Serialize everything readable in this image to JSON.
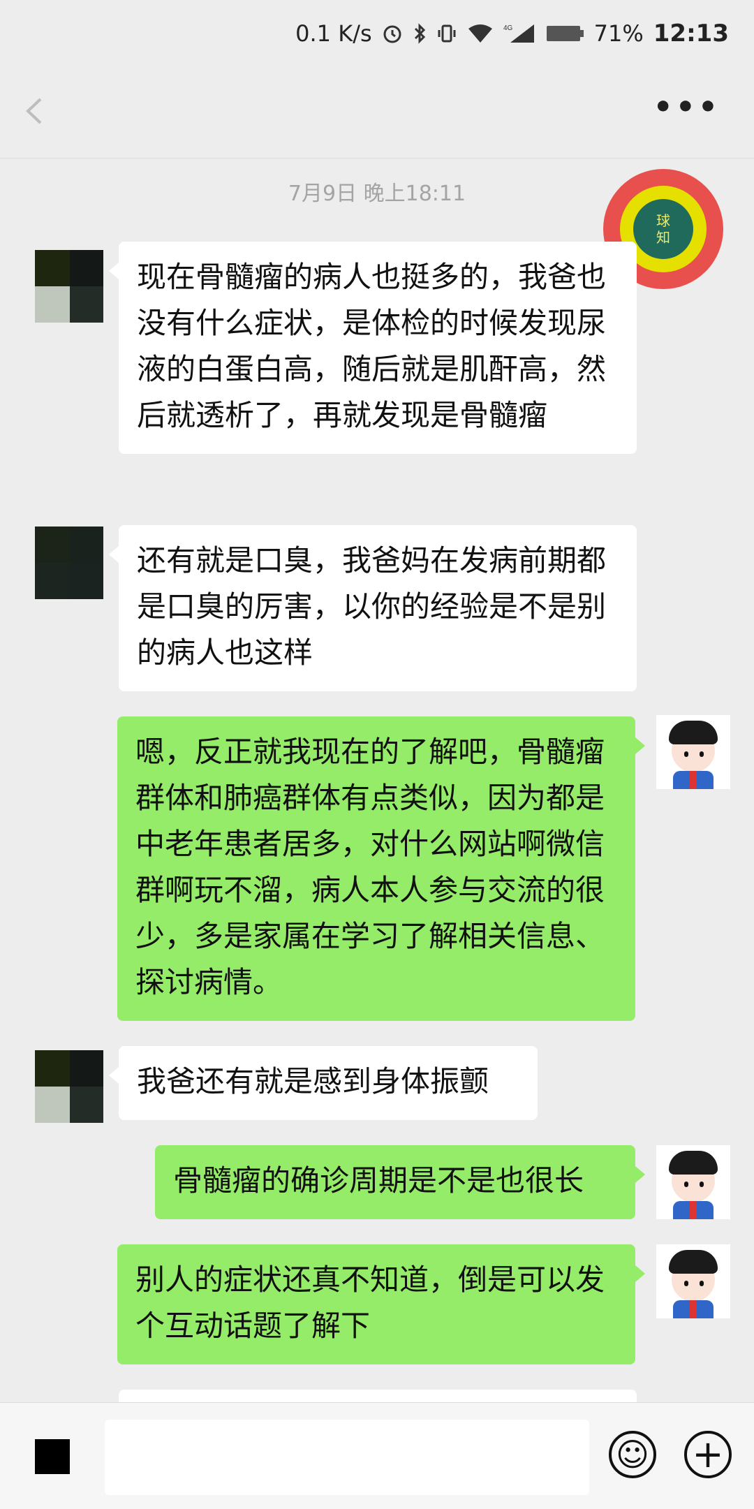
{
  "status_bar": {
    "speed": "0.1 K/s",
    "battery": "71%",
    "time": "12:13",
    "icons": [
      "alarm-icon",
      "bluetooth-icon",
      "vibrate-icon",
      "wifi-icon",
      "4g-signal-icon",
      "battery-icon"
    ]
  },
  "nav_bar": {
    "back_icon": "back-arrow-icon",
    "more_label": "•••"
  },
  "timestamp": "7月9日 晚上18:11",
  "badge": {
    "line1": "球",
    "line2": "知"
  },
  "messages": [
    {
      "side": "in",
      "text": "现在骨髓瘤的病人也挺多的，我爸也没有什么症状，是体检的时候发现尿液的白蛋白高，随后就是肌酐高，然后就透析了，再就发现是骨髓瘤"
    },
    {
      "side": "in",
      "text": "还有就是口臭，我爸妈在发病前期都是口臭的厉害，以你的经验是不是别的病人也这样"
    },
    {
      "side": "out",
      "text": "嗯，反正就我现在的了解吧，骨髓瘤群体和肺癌群体有点类似，因为都是中老年患者居多，对什么网站啊微信群啊玩不溜，病人本人参与交流的很少，多是家属在学习了解相关信息、探讨病情。"
    },
    {
      "side": "in",
      "text": "我爸还有就是感到身体振颤"
    },
    {
      "side": "out",
      "text": "骨髓瘤的确诊周期是不是也很长"
    },
    {
      "side": "out",
      "text": "别人的症状还真不知道，倒是可以发个互动话题了解下"
    }
  ],
  "input_bar": {
    "placeholder": "",
    "emoji_icon": "☺",
    "plus_icon": "+"
  }
}
